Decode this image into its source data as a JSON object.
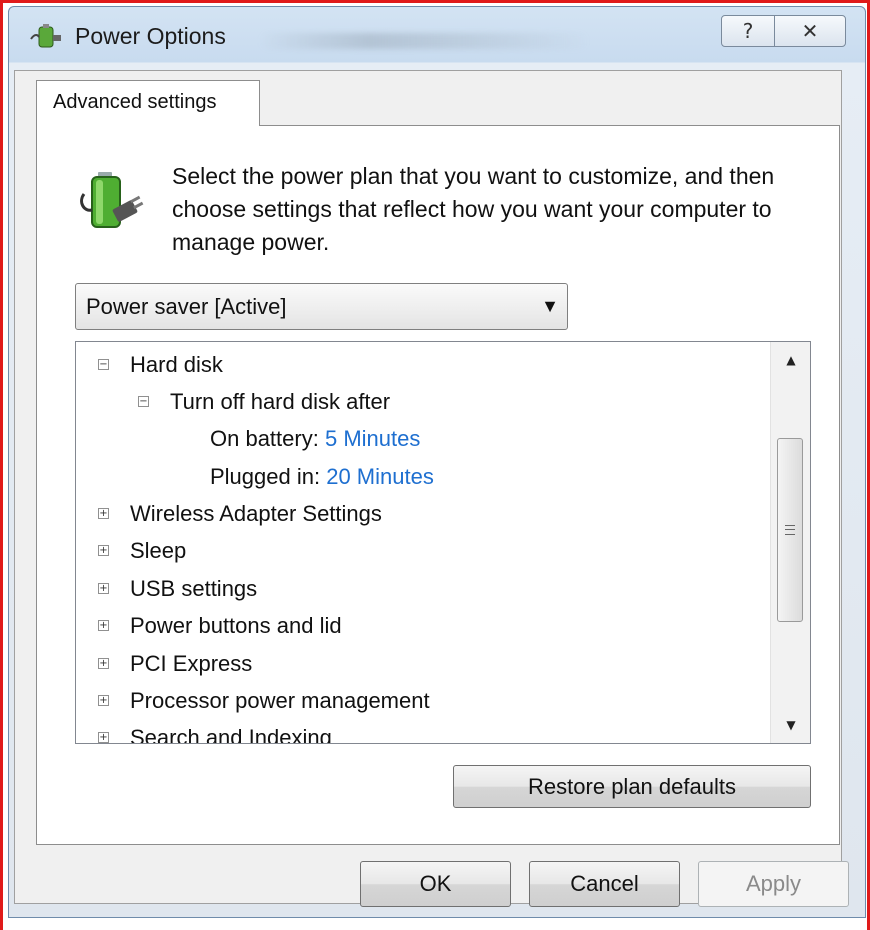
{
  "window": {
    "title": "Power Options",
    "help_glyph": "?",
    "close_glyph": "✕",
    "icon": "power-options-icon"
  },
  "tabs": [
    {
      "label": "Advanced settings",
      "active": true
    }
  ],
  "intro": {
    "text": "Select the power plan that you want to customize, and then choose settings that reflect how you want your computer to manage power.",
    "icon": "battery-plug-icon"
  },
  "plan_select": {
    "value": "Power saver [Active]"
  },
  "tree": {
    "hard_disk": "Hard disk",
    "turn_off": "Turn off hard disk after",
    "on_battery_label": "On battery:",
    "on_battery_value": "5 Minutes",
    "plugged_in_label": "Plugged in:",
    "plugged_in_value": "20 Minutes",
    "items": [
      "Wireless Adapter Settings",
      "Sleep",
      "USB settings",
      "Power buttons and lid",
      "PCI Express",
      "Processor power management",
      "Search and Indexing"
    ]
  },
  "buttons": {
    "restore": "Restore plan defaults",
    "ok": "OK",
    "cancel": "Cancel",
    "apply": "Apply"
  },
  "colors": {
    "link_value": "#1e6fd0",
    "frame_highlight": "#e01a1a"
  }
}
